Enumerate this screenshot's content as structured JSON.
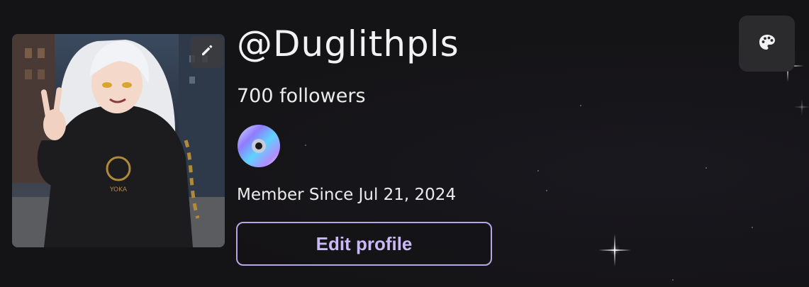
{
  "profile": {
    "username": "@Duglithpls",
    "followers_text": "700 followers",
    "member_since_text": "Member Since Jul 21, 2024",
    "edit_profile_label": "Edit profile"
  },
  "icons": {
    "edit_avatar": "pencil-icon",
    "badge": "disc-icon",
    "theme": "palette-icon"
  },
  "colors": {
    "background": "#141315",
    "accent": "#c9b9f5",
    "accent_border": "#b7a6e6",
    "text": "#ececec",
    "button_bg": "#2b2a2d"
  }
}
